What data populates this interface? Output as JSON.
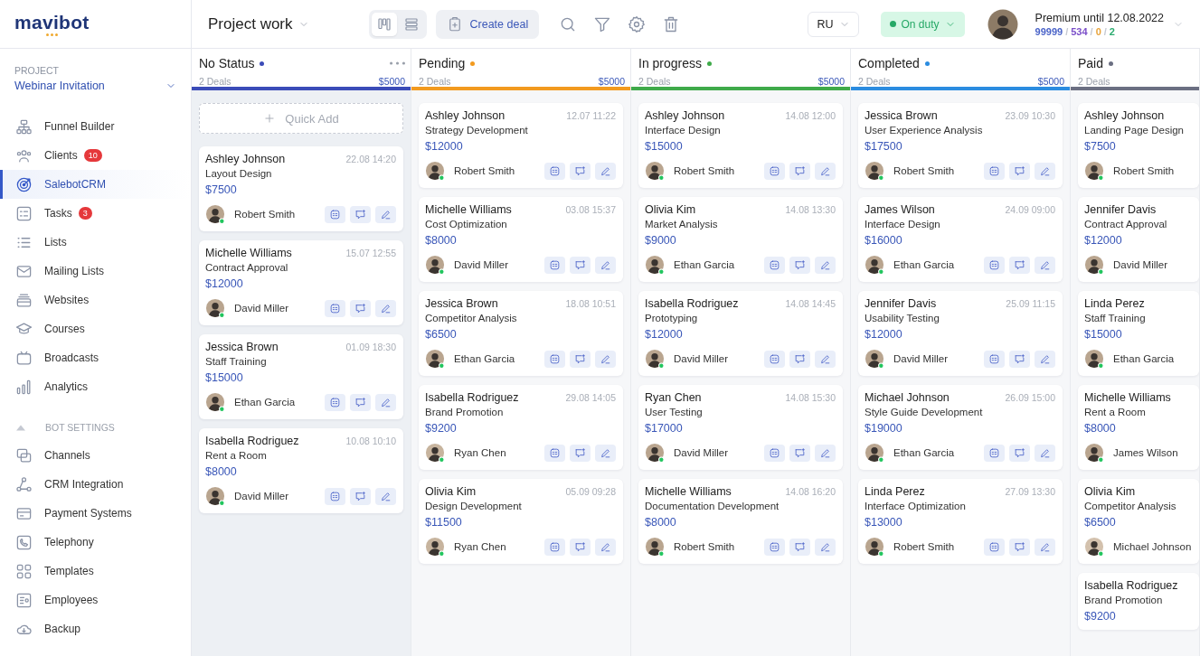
{
  "logo": {
    "text": "mavibot"
  },
  "header": {
    "title": "Project work",
    "views": [
      {
        "kind": "kanban",
        "selected": true
      },
      {
        "kind": "list",
        "selected": false
      }
    ],
    "create_button": "Create deal",
    "language": "RU",
    "status": "On duty",
    "account": {
      "plan": "Premium until 12.08.2022",
      "separator": "/",
      "stats": [
        {
          "text": "99999",
          "color": "#4a63c8"
        },
        {
          "text": "534",
          "color": "#7b4fc9"
        },
        {
          "text": "0",
          "color": "#e8a33a"
        },
        {
          "text": "2",
          "color": "#2bab6f"
        }
      ]
    }
  },
  "sidebar": {
    "project_label": "PROJECT",
    "project": "Webinar Invitation",
    "sections": [
      {
        "items": [
          {
            "label": "Funnel Builder",
            "selected": false
          },
          {
            "label": "Clients",
            "badge": "10",
            "selected": false
          },
          {
            "label": "SalebotCRM",
            "selected": true
          },
          {
            "label": "Tasks",
            "badge": "3",
            "selected": false
          },
          {
            "label": "Lists",
            "selected": false
          },
          {
            "label": "Mailing Lists",
            "selected": false
          },
          {
            "label": "Websites",
            "selected": false
          },
          {
            "label": "Courses",
            "selected": false
          },
          {
            "label": "Broadcasts",
            "selected": false
          },
          {
            "label": "Analytics",
            "selected": false
          }
        ]
      },
      {
        "title": "BOT SETTINGS",
        "expanded": true,
        "items": [
          {
            "label": "Channels",
            "selected": false
          },
          {
            "label": "CRM Integration",
            "selected": false
          },
          {
            "label": "Payment Systems",
            "selected": false
          },
          {
            "label": "Telephony",
            "selected": false
          },
          {
            "label": "Templates",
            "selected": false
          },
          {
            "label": "Employees",
            "selected": false
          },
          {
            "label": "Backup",
            "selected": false
          }
        ]
      }
    ]
  },
  "columns": [
    {
      "title": "No Status",
      "color": "#3b4cb8",
      "deals": "2 Deals",
      "total": "$5000",
      "menu": true,
      "quick_add": "Quick Add",
      "cards": [
        {
          "name": "Ashley Johnson",
          "time": "22.08 14:20",
          "title": "Layout Design",
          "amount": "$7500",
          "person": "Robert Smith",
          "actions": true
        },
        {
          "name": "Michelle Williams",
          "time": "15.07 12:55",
          "title": "Contract Approval",
          "amount": "$12000",
          "person": "David Miller",
          "actions": true
        },
        {
          "name": "Jessica Brown",
          "time": "01.09 18:30",
          "title": "Staff Training",
          "amount": "$15000",
          "person": "Ethan Garcia",
          "actions": true
        },
        {
          "name": "Isabella Rodriguez",
          "time": "10.08 10:10",
          "title": "Rent a Room",
          "amount": "$8000",
          "person": "David Miller",
          "actions": true
        }
      ]
    },
    {
      "title": "Pending",
      "color": "#f29a1f",
      "deals": "2 Deals",
      "total": "$5000",
      "menu": false,
      "cards": [
        {
          "name": "Ashley Johnson",
          "time": "12.07 11:22",
          "title": "Strategy Development",
          "amount": "$12000",
          "person": "Robert Smith",
          "actions": true
        },
        {
          "name": "Michelle Williams",
          "time": "03.08 15:37",
          "title": "Cost Optimization",
          "amount": "$8000",
          "person": "David Miller",
          "actions": true
        },
        {
          "name": "Jessica Brown",
          "time": "18.08 10:51",
          "title": "Competitor Analysis",
          "amount": "$6500",
          "person": "Ethan Garcia",
          "actions": true
        },
        {
          "name": "Isabella Rodriguez",
          "time": "29.08 14:05",
          "title": "Brand Promotion",
          "amount": "$9200",
          "person": "Ryan Chen",
          "actions": true
        },
        {
          "name": "Olivia Kim",
          "time": "05.09 09:28",
          "title": "Design Development",
          "amount": "$11500",
          "person": "Ryan Chen",
          "actions": true
        }
      ]
    },
    {
      "title": "In progress",
      "color": "#3faa4a",
      "deals": "2 Deals",
      "total": "$5000",
      "menu": false,
      "cards": [
        {
          "name": "Ashley Johnson",
          "time": "14.08 12:00",
          "title": "Interface Design",
          "amount": "$15000",
          "person": "Robert Smith",
          "actions": true
        },
        {
          "name": "Olivia Kim",
          "time": "14.08 13:30",
          "title": "Market Analysis",
          "amount": "$9000",
          "person": "Ethan Garcia",
          "actions": true
        },
        {
          "name": "Isabella Rodriguez",
          "time": "14.08 14:45",
          "title": "Prototyping",
          "amount": "$12000",
          "person": "David Miller",
          "actions": true
        },
        {
          "name": "Ryan Chen",
          "time": "14.08 15:30",
          "title": "User Testing",
          "amount": "$17000",
          "person": "David Miller",
          "actions": true
        },
        {
          "name": "Michelle Williams",
          "time": "14.08 16:20",
          "title": "Documentation Development",
          "amount": "$8000",
          "person": "Robert Smith",
          "actions": true
        }
      ]
    },
    {
      "title": "Completed",
      "color": "#2b8ce0",
      "deals": "2 Deals",
      "total": "$5000",
      "menu": false,
      "cards": [
        {
          "name": "Jessica Brown",
          "time": "23.09 10:30",
          "title": "User Experience Analysis",
          "amount": "$17500",
          "person": "Robert Smith",
          "actions": true
        },
        {
          "name": "James Wilson",
          "time": "24.09 09:00",
          "title": "Interface Design",
          "amount": "$16000",
          "person": "Ethan Garcia",
          "actions": true
        },
        {
          "name": "Jennifer Davis",
          "time": "25.09 11:15",
          "title": "Usability Testing",
          "amount": "$12000",
          "person": "David Miller",
          "actions": true
        },
        {
          "name": "Michael Johnson",
          "time": "26.09 15:00",
          "title": "Style Guide Development",
          "amount": "$19000",
          "person": "Ethan Garcia",
          "actions": true
        },
        {
          "name": "Linda Perez",
          "time": "27.09 13:30",
          "title": "Interface Optimization",
          "amount": "$13000",
          "person": "Robert Smith",
          "actions": true
        }
      ]
    },
    {
      "title": "Paid",
      "color": "#6b6f82",
      "deals": "2 Deals",
      "menu": false,
      "cards": [
        {
          "name": "Ashley Johnson",
          "title": "Landing Page Design",
          "amount": "$7500",
          "person": "Robert Smith"
        },
        {
          "name": "Jennifer Davis",
          "title": "Contract Approval",
          "amount": "$12000",
          "person": "David Miller"
        },
        {
          "name": "Linda Perez",
          "title": "Staff Training",
          "amount": "$15000",
          "person": "Ethan Garcia"
        },
        {
          "name": "Michelle Williams",
          "title": "Rent a Room",
          "amount": "$8000",
          "person": "James Wilson"
        },
        {
          "name": "Olivia Kim",
          "title": "Competitor Analysis",
          "amount": "$6500",
          "person": "Michael Johnson"
        },
        {
          "name": "Isabella Rodriguez",
          "title": "Brand Promotion",
          "amount": "$9200"
        }
      ]
    }
  ]
}
